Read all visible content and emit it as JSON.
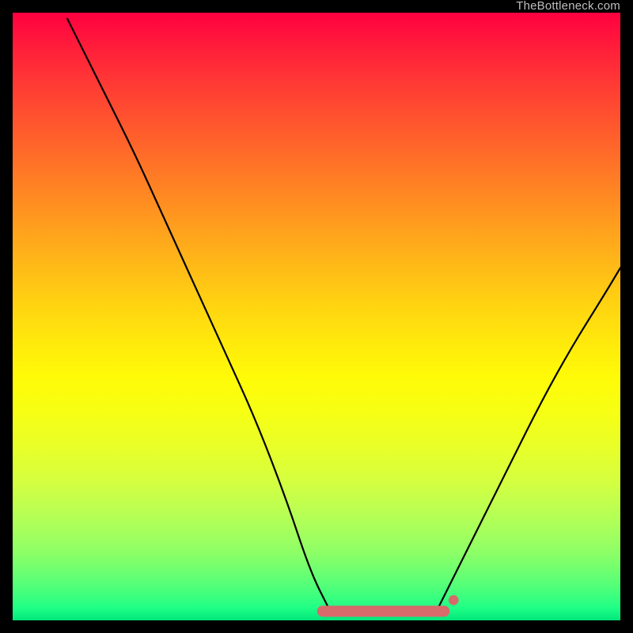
{
  "watermark": "TheBottleneck.com",
  "chart_data": {
    "type": "line",
    "title": "",
    "xlabel": "",
    "ylabel": "",
    "xlim": [
      0,
      100
    ],
    "ylim": [
      0,
      100
    ],
    "series": [
      {
        "name": "curve-left",
        "x": [
          9,
          15,
          20,
          25,
          30,
          35,
          40,
          45,
          49,
          52
        ],
        "values": [
          99,
          87,
          77,
          66,
          55,
          44,
          33,
          20,
          8,
          2
        ]
      },
      {
        "name": "curve-right",
        "x": [
          70,
          73,
          77,
          82,
          87,
          92,
          97,
          100
        ],
        "values": [
          2,
          8,
          16,
          26,
          36,
          45,
          53,
          58
        ]
      }
    ],
    "flat_bottom": {
      "name": "flat-bottom-band",
      "x_start": 51,
      "x_end": 71,
      "y": 1.5,
      "color": "#d76a6a",
      "thickness": 14,
      "endcap_radius": 9
    },
    "colors": {
      "curve": "#000000",
      "background_top": "#ff0040",
      "background_bottom": "#00e67a",
      "frame": "#000000",
      "watermark": "#bfbfbf"
    }
  }
}
